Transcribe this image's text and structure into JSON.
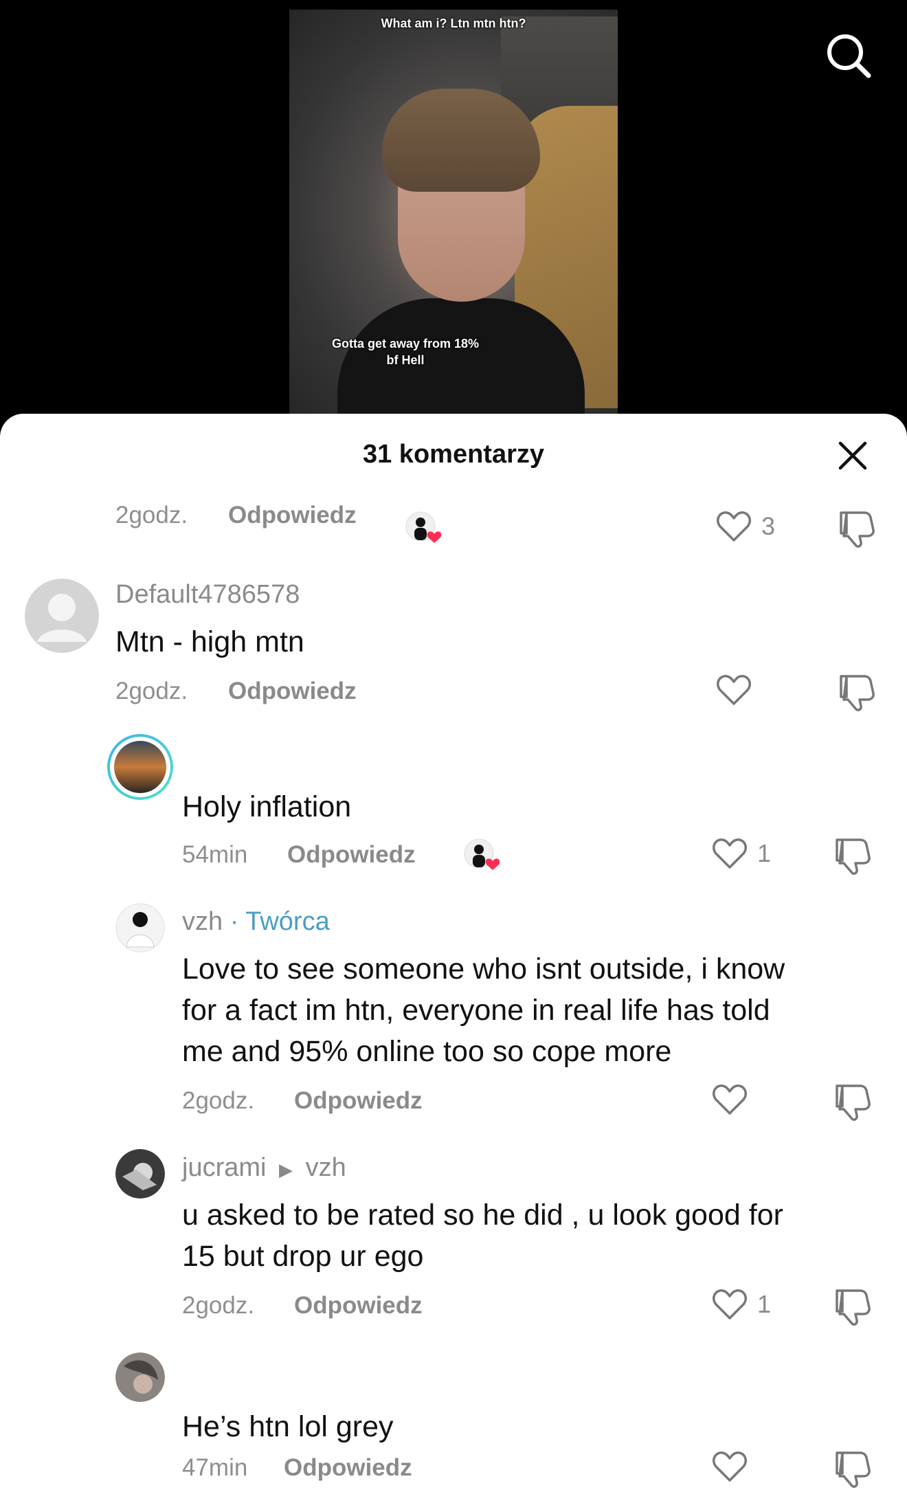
{
  "video": {
    "caption_top": "What am i? Ltn mtn htn?",
    "caption_bottom_line1": "Gotta get away from 18%",
    "caption_bottom_line2": "bf Hell",
    "search_icon": "search-icon"
  },
  "sheet": {
    "title": "31 komentarzy",
    "close_icon": "close-icon"
  },
  "comments": [
    {
      "time": "2godz.",
      "reply": "Odpowiedz",
      "likes": "3",
      "creator_liked": true
    },
    {
      "username": "Default4786578",
      "text": "Mtn - high mtn",
      "time": "2godz.",
      "reply": "Odpowiedz",
      "likes": ""
    },
    {
      "username": "",
      "text": "Holy inflation",
      "time": "54min",
      "reply": "Odpowiedz",
      "likes": "1",
      "creator_liked": true
    },
    {
      "username": "vzh",
      "badge": "· Twórca",
      "text_line1": "Love to see someone who isnt outside, i know",
      "text_line2": "for a fact im htn, everyone in real life has told",
      "text_line3": "me and 95% online too so cope more",
      "time": "2godz.",
      "reply": "Odpowiedz",
      "likes": ""
    },
    {
      "username": "jucrami",
      "reply_to": "vzh",
      "text_line1": "u asked to be rated so he did , u look good for",
      "text_line2": "15 but drop ur ego",
      "time": "2godz.",
      "reply": "Odpowiedz",
      "likes": "1"
    },
    {
      "username": "",
      "text": "He’s htn lol grey",
      "time": "47min",
      "reply": "Odpowiedz",
      "likes": ""
    }
  ],
  "colors": {
    "creator_badge": "#4a9ec1",
    "like_heart": "#fe2c55",
    "muted_text": "#8a8a8a"
  }
}
